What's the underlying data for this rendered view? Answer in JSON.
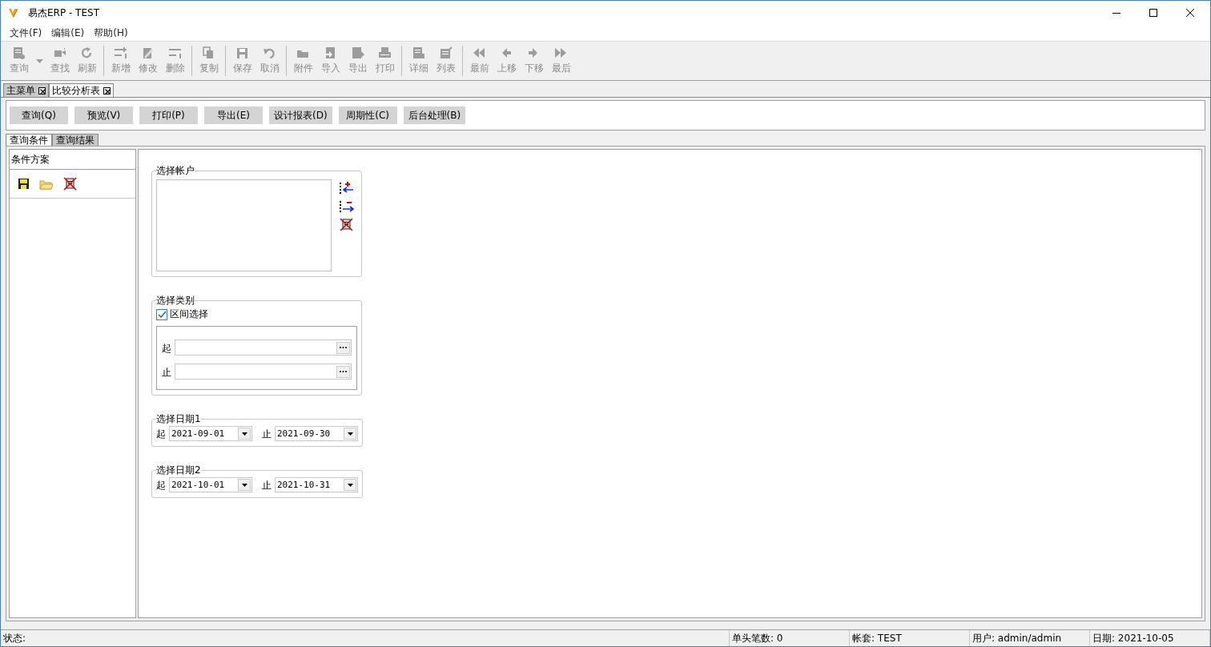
{
  "window": {
    "title": "易杰ERP - TEST"
  },
  "menu": [
    {
      "label": "文件(F)"
    },
    {
      "label": "编辑(E)"
    },
    {
      "label": "帮助(H)"
    }
  ],
  "toolbar": {
    "groups": [
      {
        "items": [
          {
            "label": "查询",
            "kind": "dropdown",
            "disabled": true
          },
          {
            "label": "查找",
            "kind": "button",
            "disabled": true
          },
          {
            "label": "刷新",
            "kind": "button",
            "disabled": true
          }
        ]
      },
      {
        "items": [
          {
            "label": "新增",
            "kind": "button",
            "disabled": true
          },
          {
            "label": "修改",
            "kind": "button",
            "disabled": true
          },
          {
            "label": "删除",
            "kind": "button",
            "disabled": true
          }
        ]
      },
      {
        "items": [
          {
            "label": "复制",
            "kind": "button",
            "disabled": true
          }
        ]
      },
      {
        "items": [
          {
            "label": "保存",
            "kind": "button",
            "disabled": true
          },
          {
            "label": "取消",
            "kind": "button",
            "disabled": true
          }
        ]
      },
      {
        "items": [
          {
            "label": "附件",
            "kind": "button",
            "disabled": true
          },
          {
            "label": "导入",
            "kind": "button",
            "disabled": true
          },
          {
            "label": "导出",
            "kind": "button",
            "disabled": true
          },
          {
            "label": "打印",
            "kind": "button",
            "disabled": true
          }
        ]
      },
      {
        "items": [
          {
            "label": "详细",
            "kind": "button",
            "disabled": true
          },
          {
            "label": "列表",
            "kind": "button",
            "disabled": true
          }
        ]
      },
      {
        "items": [
          {
            "label": "最前",
            "kind": "button",
            "disabled": true
          },
          {
            "label": "上移",
            "kind": "button",
            "disabled": true
          },
          {
            "label": "下移",
            "kind": "button",
            "disabled": true
          },
          {
            "label": "最后",
            "kind": "button",
            "disabled": true
          }
        ]
      }
    ]
  },
  "doc_tabs": [
    {
      "label": "主菜单",
      "selected": false
    },
    {
      "label": "比较分析表",
      "selected": true
    }
  ],
  "actions": [
    {
      "label": "查询(Q)"
    },
    {
      "label": "预览(V)"
    },
    {
      "label": "打印(P)"
    },
    {
      "label": "导出(E)"
    },
    {
      "label": "设计报表(D)"
    },
    {
      "label": "周期性(C)"
    },
    {
      "label": "后台处理(B)"
    }
  ],
  "view_tabs": [
    {
      "label": "查询条件",
      "selected": true
    },
    {
      "label": "查询结果",
      "selected": false
    }
  ],
  "scheme_panel": {
    "title": "条件方案"
  },
  "account_group": {
    "title": "选择帐户"
  },
  "category_group": {
    "title": "选择类别",
    "range": {
      "label": "区间选择",
      "checked": true
    },
    "fields": [
      {
        "label": "起"
      },
      {
        "label": "止"
      }
    ]
  },
  "date_groups": [
    {
      "title": "选择日期1",
      "from_label": "起",
      "from": "2021-09-01",
      "to_label": "止",
      "to": "2021-09-30"
    },
    {
      "title": "选择日期2",
      "from_label": "起",
      "from": "2021-10-01",
      "to_label": "止",
      "to": "2021-10-31"
    }
  ],
  "status_bar": {
    "status": "状态:",
    "cells": [
      {
        "text": "单头笔数: 0"
      },
      {
        "text": "帐套: TEST"
      },
      {
        "text": "用户: admin/admin"
      },
      {
        "text": "日期: 2021-10-05"
      }
    ]
  }
}
